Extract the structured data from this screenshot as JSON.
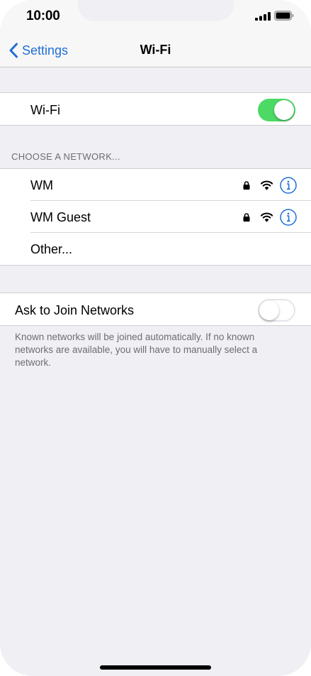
{
  "status_bar": {
    "time": "10:00",
    "signal_icon": "cellular-signal-icon",
    "battery_icon": "battery-icon"
  },
  "nav": {
    "back_label": "Settings",
    "back_icon": "chevron-left-icon",
    "title": "Wi-Fi"
  },
  "wifi_toggle": {
    "label": "Wi-Fi",
    "state": "on"
  },
  "networks": {
    "header": "CHOOSE A NETWORK...",
    "items": [
      {
        "name": "WM",
        "secured": true,
        "icons": [
          "lock-icon",
          "wifi-icon",
          "info-icon"
        ]
      },
      {
        "name": "WM Guest",
        "secured": true,
        "icons": [
          "lock-icon",
          "wifi-icon",
          "info-icon"
        ]
      },
      {
        "name": "Other..."
      }
    ]
  },
  "ask_to_join": {
    "label": "Ask to Join Networks",
    "state": "off",
    "note": "Known networks will be joined automatically. If no known networks are available, you will have to manually select a network."
  },
  "colors": {
    "accent": "#1f6fd6",
    "toggle_on": "#4cd964",
    "background": "#efeff4"
  }
}
